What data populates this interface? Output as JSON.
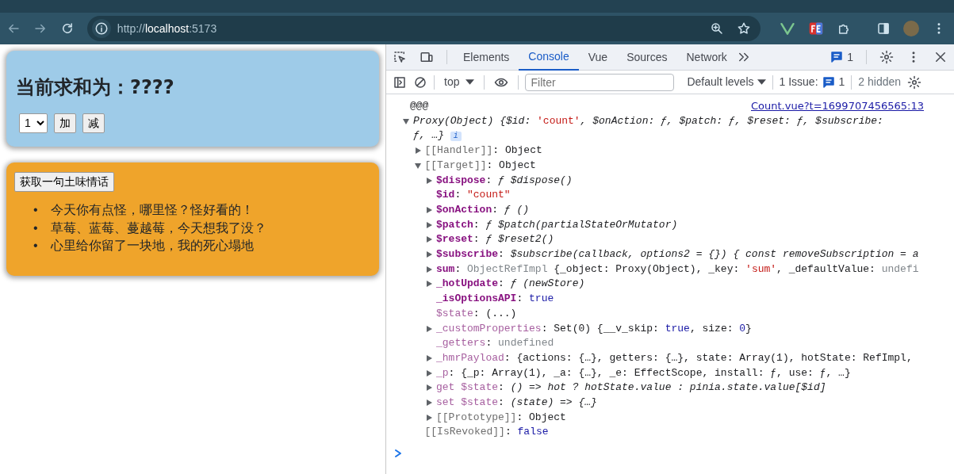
{
  "browser": {
    "url_scheme": "http://",
    "url_host": "localhost",
    "url_port": ":5173"
  },
  "page": {
    "sum_title": "当前求和为：????",
    "select_value": "1",
    "buttons": [
      "加",
      "减"
    ],
    "fetch_button": "获取一句土味情话",
    "talks": [
      {
        "marker": "•",
        "text": "今天你有点怪，哪里怪？怪好看的！"
      },
      {
        "marker": "•",
        "text": "草莓、蓝莓、蔓越莓，今天想我了没？"
      },
      {
        "marker": "•",
        "text": "心里给你留了一块地，我的死心塌地"
      }
    ]
  },
  "devtools": {
    "tabs": [
      {
        "label": "Elements",
        "selected": false
      },
      {
        "label": "Console",
        "selected": true
      },
      {
        "label": "Vue",
        "selected": false
      },
      {
        "label": "Sources",
        "selected": false
      },
      {
        "label": "Network",
        "selected": false
      }
    ],
    "message_count": "1",
    "context": "top",
    "filter_placeholder": "Filter",
    "levels": "Default levels",
    "issues_label": "1 Issue:",
    "issues_count": "1",
    "hidden": "2 hidden"
  },
  "console": {
    "log": {
      "text": "@@@",
      "source": "Count.vue?t=1699707456565:13"
    },
    "object": {
      "kind": "branch",
      "expanded": true,
      "summary": [
        {
          "text": "Proxy(Object) {$id: ",
          "kind": "italic"
        },
        {
          "text": "'count'",
          "kind": "string"
        },
        {
          "text": ", $onAction: ƒ, $patch: ƒ, $reset: ƒ, $subscribe: ƒ, …}",
          "kind": "italic"
        }
      ],
      "badge": "i",
      "children": [
        {
          "kind": "branch",
          "expanded": false,
          "line": [
            {
              "text": "[[Handler]]",
              "kind": "key_internal"
            },
            {
              "text": ": Object",
              "kind": "plain"
            }
          ]
        },
        {
          "kind": "branch",
          "expanded": true,
          "line": [
            {
              "text": "[[Target]]",
              "kind": "key_internal"
            },
            {
              "text": ": Object",
              "kind": "plain"
            }
          ],
          "children": [
            {
              "kind": "branch",
              "expanded": false,
              "line": [
                {
                  "text": "$dispose",
                  "kind": "key_own"
                },
                {
                  "text": ": ",
                  "kind": "plain"
                },
                {
                  "text": "ƒ $dispose()",
                  "kind": "italic"
                }
              ]
            },
            {
              "kind": "leaf",
              "line": [
                {
                  "text": "$id",
                  "kind": "key_own"
                },
                {
                  "text": ": ",
                  "kind": "plain"
                },
                {
                  "text": "\"count\"",
                  "kind": "string"
                }
              ]
            },
            {
              "kind": "branch",
              "expanded": false,
              "line": [
                {
                  "text": "$onAction",
                  "kind": "key_own"
                },
                {
                  "text": ": ",
                  "kind": "plain"
                },
                {
                  "text": "ƒ ()",
                  "kind": "italic"
                }
              ]
            },
            {
              "kind": "branch",
              "expanded": false,
              "line": [
                {
                  "text": "$patch",
                  "kind": "key_own"
                },
                {
                  "text": ": ",
                  "kind": "plain"
                },
                {
                  "text": "ƒ $patch(partialStateOrMutator)",
                  "kind": "italic"
                }
              ]
            },
            {
              "kind": "branch",
              "expanded": false,
              "line": [
                {
                  "text": "$reset",
                  "kind": "key_own"
                },
                {
                  "text": ": ",
                  "kind": "plain"
                },
                {
                  "text": "ƒ $reset2()",
                  "kind": "italic"
                }
              ]
            },
            {
              "kind": "branch",
              "expanded": false,
              "line": [
                {
                  "text": "$subscribe",
                  "kind": "key_own"
                },
                {
                  "text": ": ",
                  "kind": "plain"
                },
                {
                  "text": "$subscribe(callback, options2 = {}) { const removeSubscription = a",
                  "kind": "italic"
                }
              ]
            },
            {
              "kind": "branch",
              "expanded": false,
              "line": [
                {
                  "text": "sum",
                  "kind": "key_own"
                },
                {
                  "text": ": ",
                  "kind": "plain"
                },
                {
                  "text": "ObjectRefImpl ",
                  "kind": "gray"
                },
                {
                  "text": "{_object: Proxy(Object), _key: ",
                  "kind": "plain"
                },
                {
                  "text": "'sum'",
                  "kind": "string"
                },
                {
                  "text": ", _defaultValue: ",
                  "kind": "plain"
                },
                {
                  "text": "undefi",
                  "kind": "gray"
                }
              ]
            },
            {
              "kind": "branch",
              "expanded": false,
              "line": [
                {
                  "text": "_hotUpdate",
                  "kind": "key_own"
                },
                {
                  "text": ": ",
                  "kind": "plain"
                },
                {
                  "text": "ƒ (newStore)",
                  "kind": "italic"
                }
              ]
            },
            {
              "kind": "leaf",
              "line": [
                {
                  "text": "_isOptionsAPI",
                  "kind": "key_own"
                },
                {
                  "text": ": ",
                  "kind": "plain"
                },
                {
                  "text": "true",
                  "kind": "literal"
                }
              ]
            },
            {
              "kind": "leaf",
              "line": [
                {
                  "text": "$state",
                  "kind": "key_dim"
                },
                {
                  "text": ": (...)",
                  "kind": "plain"
                }
              ]
            },
            {
              "kind": "branch",
              "expanded": false,
              "line": [
                {
                  "text": "_customProperties",
                  "kind": "key_dim"
                },
                {
                  "text": ": Set(0) {__v_skip: ",
                  "kind": "plain"
                },
                {
                  "text": "true",
                  "kind": "literal"
                },
                {
                  "text": ", size: ",
                  "kind": "plain"
                },
                {
                  "text": "0",
                  "kind": "literal"
                },
                {
                  "text": "}",
                  "kind": "plain"
                }
              ]
            },
            {
              "kind": "leaf",
              "line": [
                {
                  "text": "_getters",
                  "kind": "key_dim"
                },
                {
                  "text": ": ",
                  "kind": "plain"
                },
                {
                  "text": "undefined",
                  "kind": "gray"
                }
              ]
            },
            {
              "kind": "branch",
              "expanded": false,
              "line": [
                {
                  "text": "_hmrPayload",
                  "kind": "key_dim"
                },
                {
                  "text": ": {actions: {…}, getters: {…}, state: Array(1), hotState: RefImpl,",
                  "kind": "plain"
                }
              ]
            },
            {
              "kind": "branch",
              "expanded": false,
              "line": [
                {
                  "text": "_p",
                  "kind": "key_dim"
                },
                {
                  "text": ": {_p: Array(1), _a: {…}, _e: EffectScope, install: ƒ, use: ƒ, …}",
                  "kind": "plain"
                }
              ]
            },
            {
              "kind": "branch",
              "expanded": false,
              "line": [
                {
                  "text": "get $state",
                  "kind": "key_dim"
                },
                {
                  "text": ": ",
                  "kind": "plain"
                },
                {
                  "text": "() => hot ? hotState.value : pinia.state.value[$id]",
                  "kind": "italic"
                }
              ]
            },
            {
              "kind": "branch",
              "expanded": false,
              "line": [
                {
                  "text": "set $state",
                  "kind": "key_dim"
                },
                {
                  "text": ": ",
                  "kind": "plain"
                },
                {
                  "text": "(state) => {…}",
                  "kind": "italic"
                }
              ]
            },
            {
              "kind": "branch",
              "expanded": false,
              "line": [
                {
                  "text": "[[Prototype]]",
                  "kind": "key_internal"
                },
                {
                  "text": ": Object",
                  "kind": "plain"
                }
              ]
            }
          ]
        },
        {
          "kind": "leaf",
          "line": [
            {
              "text": "[[IsRevoked]]",
              "kind": "key_internal"
            },
            {
              "text": ": ",
              "kind": "plain"
            },
            {
              "text": "false",
              "kind": "literal"
            }
          ]
        }
      ]
    }
  }
}
